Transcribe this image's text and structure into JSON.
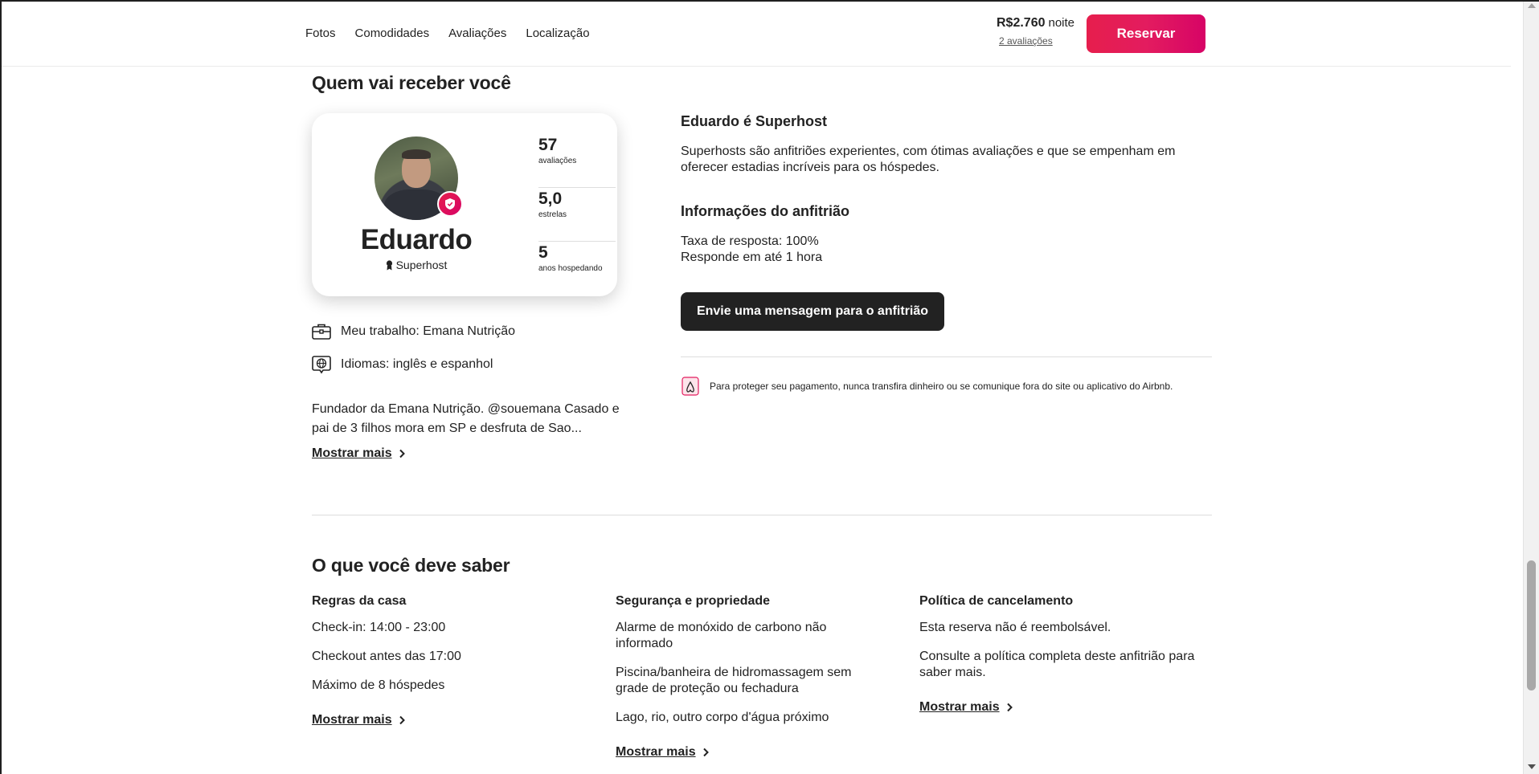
{
  "header": {
    "nav": [
      "Fotos",
      "Comodidades",
      "Avaliações",
      "Localização"
    ],
    "price": "R$2.760",
    "price_unit": "noite",
    "reviews_link": "2 avaliações",
    "reserve_label": "Reservar"
  },
  "host_section": {
    "title": "Quem vai receber você",
    "card": {
      "name": "Eduardo",
      "role": "Superhost",
      "stats": [
        {
          "value": "57",
          "label": "avaliações"
        },
        {
          "value": "5,0",
          "label": "estrelas"
        },
        {
          "value": "5",
          "label": "anos hospedando"
        }
      ]
    },
    "work": "Meu trabalho: Emana Nutrição",
    "languages": "Idiomas: inglês e espanhol",
    "bio_line1": "Fundador da Emana Nutrição. @souemana Casado e",
    "bio_line2": "pai de 3 filhos mora em SP e desfruta de Sao...",
    "show_more": "Mostrar mais",
    "superhost_title": "Eduardo é Superhost",
    "superhost_desc_line1": "Superhosts são anfitriões experientes, com ótimas avaliações e que se empenham em",
    "superhost_desc_line2": "oferecer estadias incríveis para os hóspedes.",
    "host_info_title": "Informações do anfitrião",
    "response_rate": "Taxa de resposta: 100%",
    "response_time": "Responde em até 1 hora",
    "message_button": "Envie uma mensagem para o anfitrião",
    "protect_notice": "Para proteger seu pagamento, nunca transfira dinheiro ou se comunique fora do site ou aplicativo do Airbnb."
  },
  "know_section": {
    "title": "O que você deve saber",
    "columns": [
      {
        "title": "Regras da casa",
        "items": [
          "Check-in: 14:00 - 23:00",
          "Checkout antes das 17:00",
          "Máximo de 8 hóspedes"
        ],
        "show_more": "Mostrar mais"
      },
      {
        "title": "Segurança e propriedade",
        "items": [
          [
            "Alarme de monóxido de carbono não",
            "informado"
          ],
          [
            "Piscina/banheira de hidromassagem sem",
            "grade de proteção ou fechadura"
          ],
          [
            "Lago, rio, outro corpo d'água próximo"
          ]
        ],
        "show_more": "Mostrar mais"
      },
      {
        "title": "Política de cancelamento",
        "items": [
          [
            "Esta reserva não é reembolsável."
          ],
          [
            "Consulte a política completa deste anfitrião para",
            "saber mais."
          ]
        ],
        "show_more": "Mostrar mais"
      }
    ]
  },
  "colors": {
    "brand": "#e31c5f",
    "text": "#222222",
    "divider": "#dddddd"
  }
}
